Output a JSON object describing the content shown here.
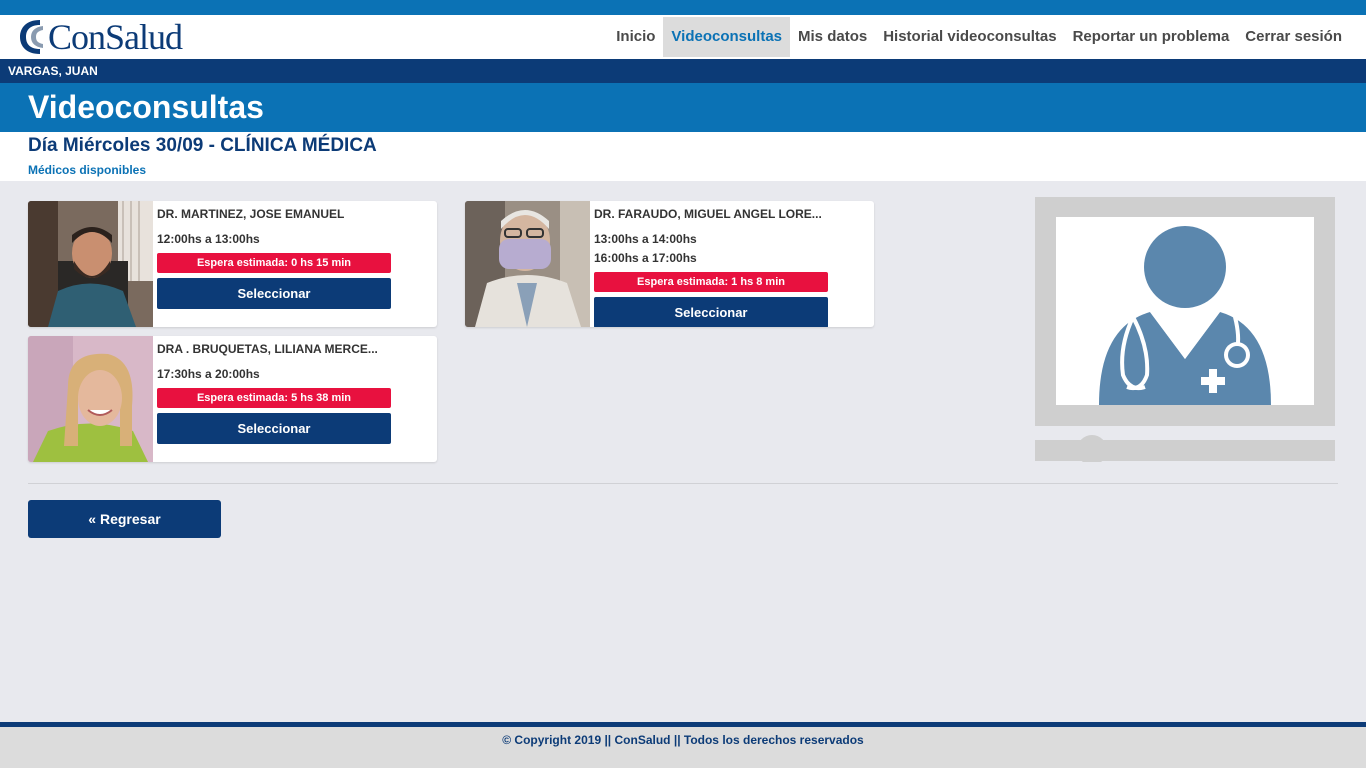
{
  "brand": {
    "name": "ConSalud",
    "color": "#0c3b77",
    "accent": "#0b72b5",
    "alert": "#e8113f"
  },
  "nav": {
    "items": [
      {
        "label": "Inicio",
        "active": false
      },
      {
        "label": "Videoconsultas",
        "active": true
      },
      {
        "label": "Mis datos",
        "active": false
      },
      {
        "label": "Historial videoconsultas",
        "active": false
      },
      {
        "label": "Reportar un problema",
        "active": false
      },
      {
        "label": "Cerrar sesión",
        "active": false
      }
    ]
  },
  "user": {
    "name": "VARGAS, JUAN"
  },
  "page": {
    "title": "Videoconsultas",
    "day_title": "Día Miércoles 30/09 - CLÍNICA MÉDICA",
    "available_label": "Médicos disponibles"
  },
  "doctors": [
    {
      "name": "DR. MARTINEZ, JOSE EMANUEL",
      "hours": [
        "12:00hs a 13:00hs"
      ],
      "wait": "Espera estimada: 0 hs 15 min",
      "select_label": "Seleccionar"
    },
    {
      "name": "DR. FARAUDO, MIGUEL ANGEL LORE...",
      "hours": [
        "13:00hs a 14:00hs",
        "16:00hs a 17:00hs"
      ],
      "wait": "Espera estimada: 1 hs 8 min",
      "select_label": "Seleccionar"
    },
    {
      "name": "DRA . BRUQUETAS, LILIANA MERCE...",
      "hours": [
        "17:30hs a 20:00hs"
      ],
      "wait": "Espera estimada: 5 hs 38 min",
      "select_label": "Seleccionar"
    }
  ],
  "illustration": {
    "icon": "doctor-video-icon"
  },
  "back_label": "« Regresar",
  "footer": {
    "copyright": "© Copyright 2019 || ConSalud || Todos los derechos reservados"
  }
}
